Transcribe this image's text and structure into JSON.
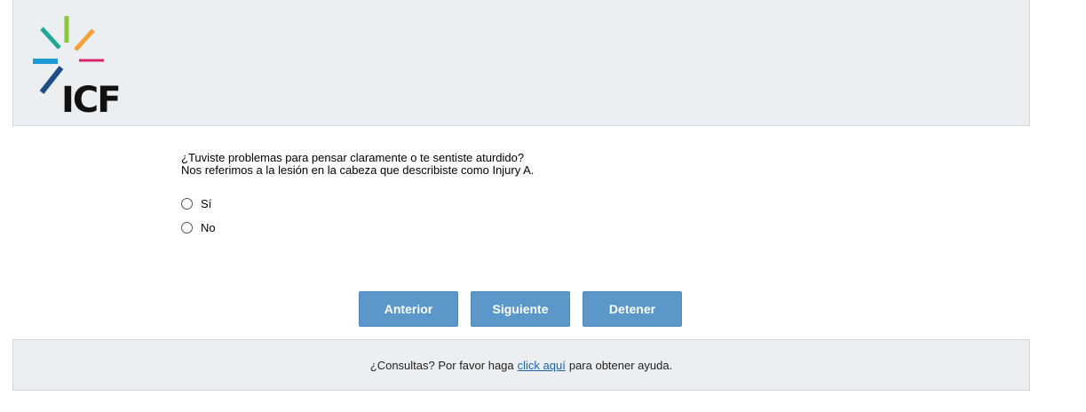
{
  "header": {
    "logo_text": "ICF"
  },
  "question": {
    "line1": "¿Tuviste problemas para pensar claramente o te sentiste aturdido?",
    "line2": "Nos referimos a la lesión en la cabeza que describiste como Injury A."
  },
  "options": [
    {
      "label": "Sí",
      "selected": false
    },
    {
      "label": "No",
      "selected": false
    }
  ],
  "buttons": {
    "previous": "Anterior",
    "next": "Siguiente",
    "stop": "Detener"
  },
  "footer": {
    "prefix": "¿Consultas? Por favor haga",
    "link": "click aquí",
    "suffix": "para obtener ayuda."
  },
  "colors": {
    "button_bg": "#5b97c9",
    "panel_bg": "#eceff2",
    "link": "#1b62b3"
  }
}
